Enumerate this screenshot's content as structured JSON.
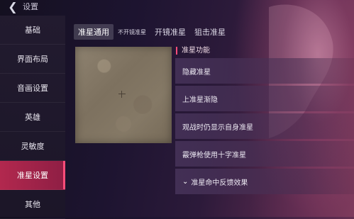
{
  "header": {
    "title": "设置",
    "back_icon": "chevron-left-icon"
  },
  "sidebar": {
    "items": [
      {
        "label": "基础"
      },
      {
        "label": "界面布局"
      },
      {
        "label": "音画设置"
      },
      {
        "label": "英雄"
      },
      {
        "label": "灵敏度"
      },
      {
        "label": "准星设置",
        "active": true
      },
      {
        "label": "其他"
      }
    ]
  },
  "tabs": [
    {
      "label": "准星通用",
      "active": true
    },
    {
      "label": "不开镜准星"
    },
    {
      "label": "开镜准星"
    },
    {
      "label": "狙击准星"
    }
  ],
  "section": {
    "label": "准星功能"
  },
  "options": [
    {
      "label": "隐藏准星"
    },
    {
      "label": "上准星渐隐"
    },
    {
      "label": "观战时仍显示自身准星"
    },
    {
      "label": "霰弹枪使用十字准星"
    },
    {
      "label": "准星命中反馈效果",
      "expandable": true
    }
  ],
  "colors": {
    "accent": "#b2284e",
    "accent_bright": "#ff4d7a"
  }
}
